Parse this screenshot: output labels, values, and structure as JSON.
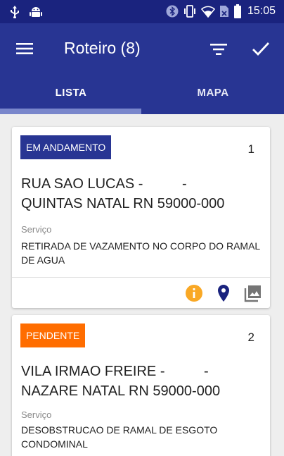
{
  "status_bar": {
    "time": "15:05",
    "icons": [
      "usb-icon",
      "android-icon",
      "bluetooth-icon",
      "vibrate-icon",
      "wifi-icon",
      "no-sim-icon",
      "battery-icon"
    ]
  },
  "app_bar": {
    "title": "Roteiro (8)",
    "icons": [
      "menu-icon",
      "filter-icon",
      "check-icon"
    ],
    "color": "#283593"
  },
  "tabs": [
    {
      "label": "LISTA",
      "selected": true
    },
    {
      "label": "MAPA",
      "selected": false
    }
  ],
  "cards": [
    {
      "status": "EM ANDAMENTO",
      "status_color": "#283593",
      "number": "1",
      "address_line1": "RUA SAO LUCAS -          -",
      "address_line2": "QUINTAS NATAL RN 59000-000",
      "service_label": "Serviço",
      "service": "RETIRADA DE VAZAMENTO NO CORPO DO RAMAL DE AGUA",
      "actions": [
        "info-icon",
        "location-pin-icon",
        "photo-icon"
      ],
      "action_colors": {
        "info": "#f9a825",
        "pin": "#1a237e",
        "photo": "#757575"
      }
    },
    {
      "status": "PENDENTE",
      "status_color": "#ff6d00",
      "number": "2",
      "address_line1": "VILA IRMAO FREIRE -          -",
      "address_line2": "NAZARE NATAL RN 59000-000",
      "service_label": "Serviço",
      "service": "DESOBSTRUCAO DE RAMAL DE ESGOTO CONDOMINAL"
    }
  ]
}
